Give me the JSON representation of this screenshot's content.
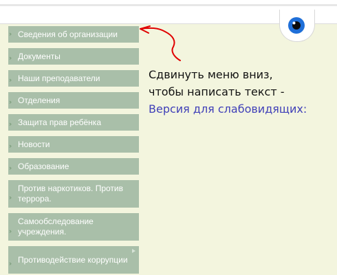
{
  "menu": {
    "items": [
      {
        "label": "Сведения об организации",
        "has_submenu": false
      },
      {
        "label": "Документы",
        "has_submenu": false
      },
      {
        "label": "Наши преподаватели",
        "has_submenu": false
      },
      {
        "label": "Отделения",
        "has_submenu": false
      },
      {
        "label": "Защита прав ребёнка",
        "has_submenu": false
      },
      {
        "label": "Новости",
        "has_submenu": false
      },
      {
        "label": "Образование",
        "has_submenu": false
      },
      {
        "label": "Против наркотиков. Против террора.",
        "has_submenu": false
      },
      {
        "label": "Самообследование учреждения.",
        "has_submenu": false
      },
      {
        "label": "Противодействие коррупции",
        "has_submenu": true
      }
    ]
  },
  "annotation": {
    "line1": "Сдвинуть меню вниз,",
    "line2": "чтобы написать текст -",
    "link": "Версия для слабовидящих:"
  },
  "icons": {
    "eye": "eye-icon",
    "bullet": "double-chevron-right-icon",
    "submenu": "triangle-right-icon",
    "annotation_arrow": "hand-drawn-arrow-icon"
  },
  "colors": {
    "page_background": "#f3f5de",
    "menu_item_background": "#a9bfa9",
    "menu_item_text": "#ffffff",
    "link_text": "#3f3fb8",
    "annotation_arrow": "#e00000",
    "eye_iris": "#1f6fd8"
  }
}
